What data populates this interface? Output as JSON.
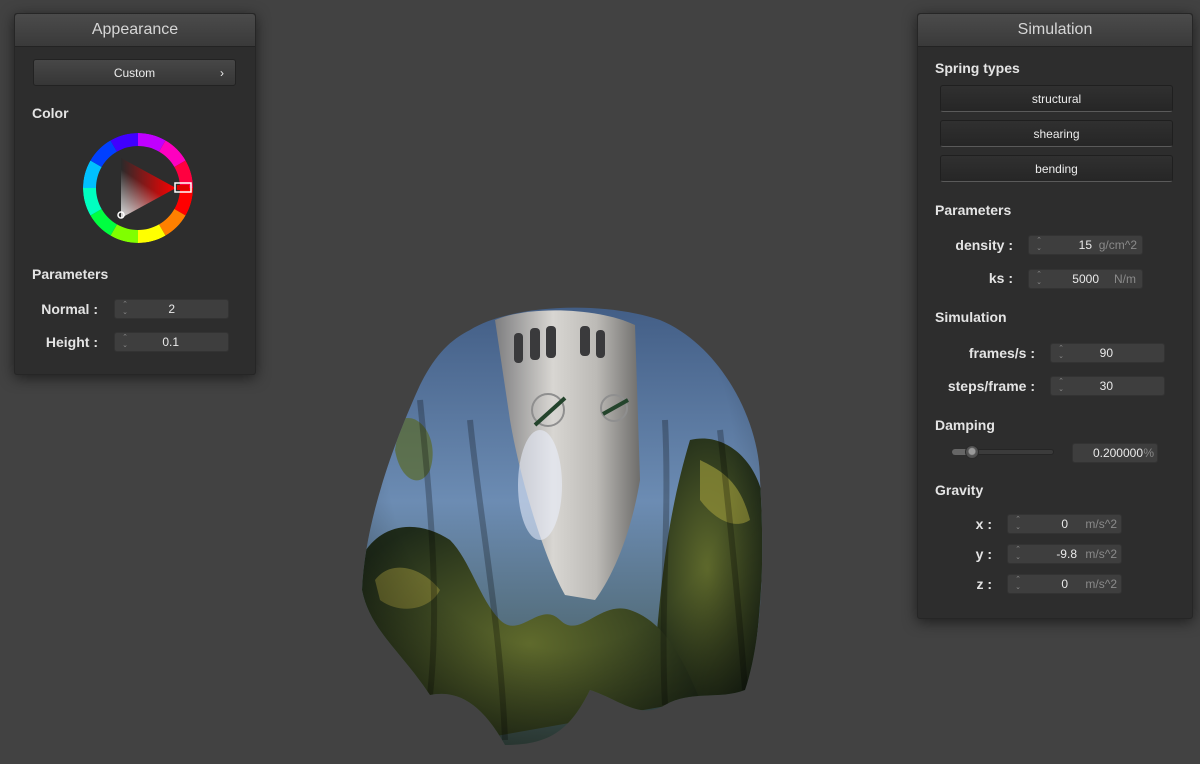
{
  "appearance": {
    "title": "Appearance",
    "preset": "Custom",
    "preset_arrow": "›",
    "color_label": "Color",
    "color_hex": "#ff0000",
    "params_label": "Parameters",
    "normal_label": "Normal :",
    "normal_value": "2",
    "height_label": "Height :",
    "height_value": "0.1"
  },
  "simulation": {
    "title": "Simulation",
    "spring_types_label": "Spring types",
    "spring_types": [
      "structural",
      "shearing",
      "bending"
    ],
    "params_label": "Parameters",
    "density_label": "density :",
    "density_value": "15",
    "density_unit": "g/cm^2",
    "ks_label": "ks :",
    "ks_value": "5000",
    "ks_unit": "N/m",
    "sim_label": "Simulation",
    "fps_label": "frames/s :",
    "fps_value": "90",
    "steps_label": "steps/frame :",
    "steps_value": "30",
    "damping_label": "Damping",
    "damping_slider_fraction": 0.2,
    "damping_value": "0.200000",
    "damping_unit": "%",
    "gravity_label": "Gravity",
    "gx_label": "x :",
    "gx_value": "0",
    "gy_label": "y :",
    "gy_value": "-9.8",
    "gz_label": "z :",
    "gz_value": "0",
    "gravity_unit": "m/s^2"
  },
  "colors": {
    "background": "#424242",
    "panel": "#2d2d2d",
    "selected_color": "#ff0000"
  }
}
